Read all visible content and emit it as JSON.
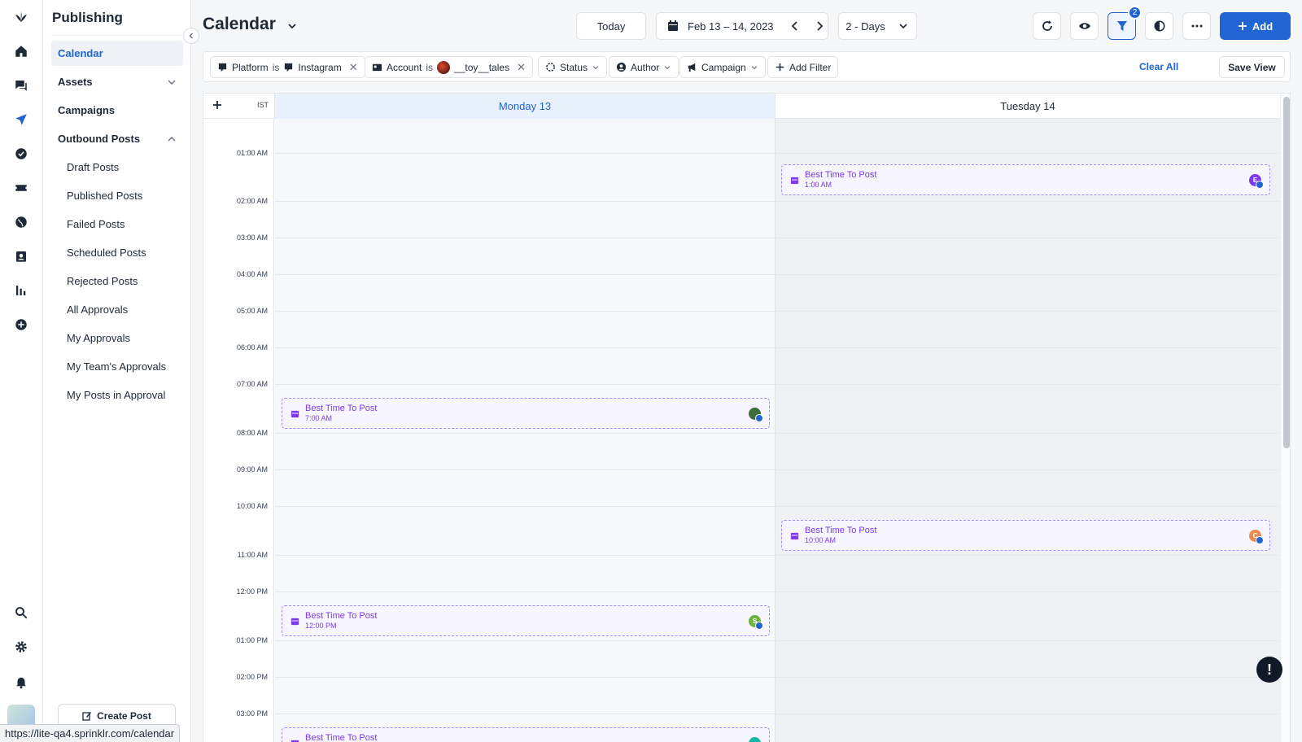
{
  "app": {
    "section_title": "Publishing",
    "url_tooltip": "https://lite-qa4.sprinklr.com/calendar"
  },
  "nav": {
    "items": [
      {
        "label": "Calendar"
      },
      {
        "label": "Assets"
      },
      {
        "label": "Campaigns"
      },
      {
        "label": "Outbound Posts"
      },
      {
        "label": "Draft Posts"
      },
      {
        "label": "Published Posts"
      },
      {
        "label": "Failed Posts"
      },
      {
        "label": "Scheduled Posts"
      },
      {
        "label": "Rejected Posts"
      },
      {
        "label": "All Approvals"
      },
      {
        "label": "My Approvals"
      },
      {
        "label": "My Team's Approvals"
      },
      {
        "label": "My Posts in Approval"
      }
    ],
    "create_post": "Create Post"
  },
  "header": {
    "title": "Calendar",
    "today": "Today",
    "date_range": "Feb 13 – 14, 2023",
    "view": "2 - Days",
    "filter_count": "2",
    "add": "Add"
  },
  "filters": {
    "platform": {
      "field": "Platform",
      "op": "is",
      "value": "Instagram"
    },
    "account": {
      "field": "Account",
      "op": "is",
      "value": "__toy__tales"
    },
    "status": "Status",
    "author": "Author",
    "campaign": "Campaign",
    "add_filter": "Add Filter",
    "clear_all": "Clear All",
    "save_view": "Save View"
  },
  "calendar": {
    "timezone": "IST",
    "days": [
      {
        "label": "Monday 13"
      },
      {
        "label": "Tuesday 14"
      }
    ],
    "hours": [
      "01:00 AM",
      "02:00 AM",
      "03:00 AM",
      "04:00 AM",
      "05:00 AM",
      "06:00 AM",
      "07:00 AM",
      "08:00 AM",
      "09:00 AM",
      "10:00 AM",
      "11:00 AM",
      "12:00 PM",
      "01:00 PM",
      "02:00 PM",
      "03:00 PM"
    ],
    "events": [
      {
        "title": "Best Time To Post",
        "time": "1:00 AM",
        "avatar": "E",
        "color": "#7c3aed"
      },
      {
        "title": "Best Time To Post",
        "time": "7:00 AM",
        "avatar": "",
        "color": "#3f6e3a"
      },
      {
        "title": "Best Time To Post",
        "time": "10:00 AM",
        "avatar": "C",
        "color": "#f08a4b"
      },
      {
        "title": "Best Time To Post",
        "time": "12:00 PM",
        "avatar": "S",
        "color": "#6db33f"
      },
      {
        "title": "Best Time To Post",
        "time": "",
        "avatar": "",
        "color": "#14b8a6"
      }
    ]
  },
  "colors": {
    "accent": "#2065d1",
    "event_purple": "#7c3aed"
  }
}
